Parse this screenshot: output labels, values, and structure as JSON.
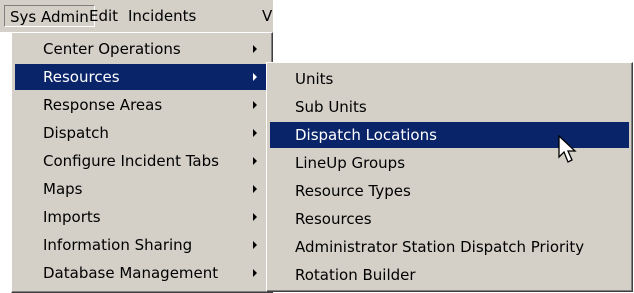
{
  "menubar": {
    "items": [
      {
        "label": "Sys Admin"
      },
      {
        "label": "Edit"
      },
      {
        "label": "Incidents"
      },
      {
        "label": "V"
      }
    ]
  },
  "main_menu": {
    "items": [
      {
        "label": "Center Operations"
      },
      {
        "label": "Resources"
      },
      {
        "label": "Response Areas"
      },
      {
        "label": "Dispatch"
      },
      {
        "label": "Configure Incident Tabs"
      },
      {
        "label": "Maps"
      },
      {
        "label": "Imports"
      },
      {
        "label": "Information Sharing"
      },
      {
        "label": "Database Management"
      }
    ]
  },
  "sub_menu": {
    "items": [
      {
        "label": "Units"
      },
      {
        "label": "Sub Units"
      },
      {
        "label": "Dispatch Locations"
      },
      {
        "label": "LineUp Groups"
      },
      {
        "label": "Resource Types"
      },
      {
        "label": "Resources"
      },
      {
        "label": "Administrator Station Dispatch Priority"
      },
      {
        "label": "Rotation Builder"
      }
    ]
  },
  "colors": {
    "menu_bg": "#d4d0c8",
    "highlight": "#0a246a",
    "highlight_text": "#ffffff"
  },
  "icons": {
    "submenu_indicator": "triangle-right-icon",
    "pointer": "mouse-cursor-icon"
  }
}
